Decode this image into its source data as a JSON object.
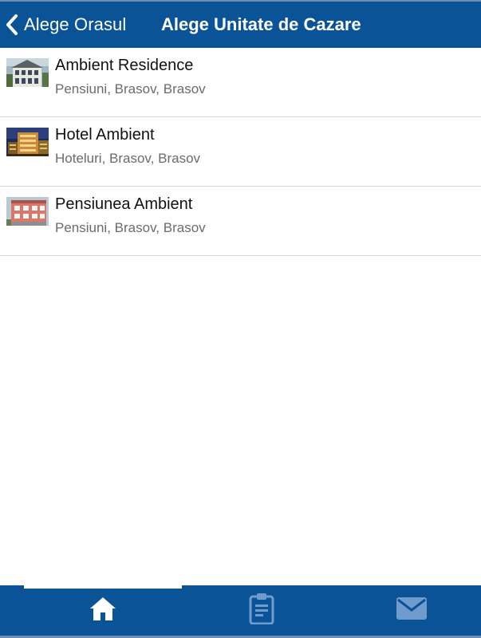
{
  "header": {
    "back_label": "Alege Orasul",
    "title": "Alege Unitate de Cazare"
  },
  "accommodations": [
    {
      "name": "Ambient Residence",
      "details": "Pensiuni, Brasov, Brasov"
    },
    {
      "name": "Hotel Ambient",
      "details": "Hoteluri, Brasov, Brasov"
    },
    {
      "name": "Pensiunea Ambient",
      "details": "Pensiuni, Brasov, Brasov"
    }
  ],
  "tabbar": {
    "tabs": [
      {
        "icon": "home-icon",
        "active": true
      },
      {
        "icon": "clipboard-icon",
        "active": false
      },
      {
        "icon": "mail-icon",
        "active": false
      }
    ]
  },
  "colors": {
    "bar_background": "#0a5396",
    "active_icon": "#ffffff",
    "inactive_icon": "#6f9ccd",
    "title_text": "#111111",
    "subtitle_text": "#6b6b6b",
    "divider": "#d5d5d5"
  }
}
